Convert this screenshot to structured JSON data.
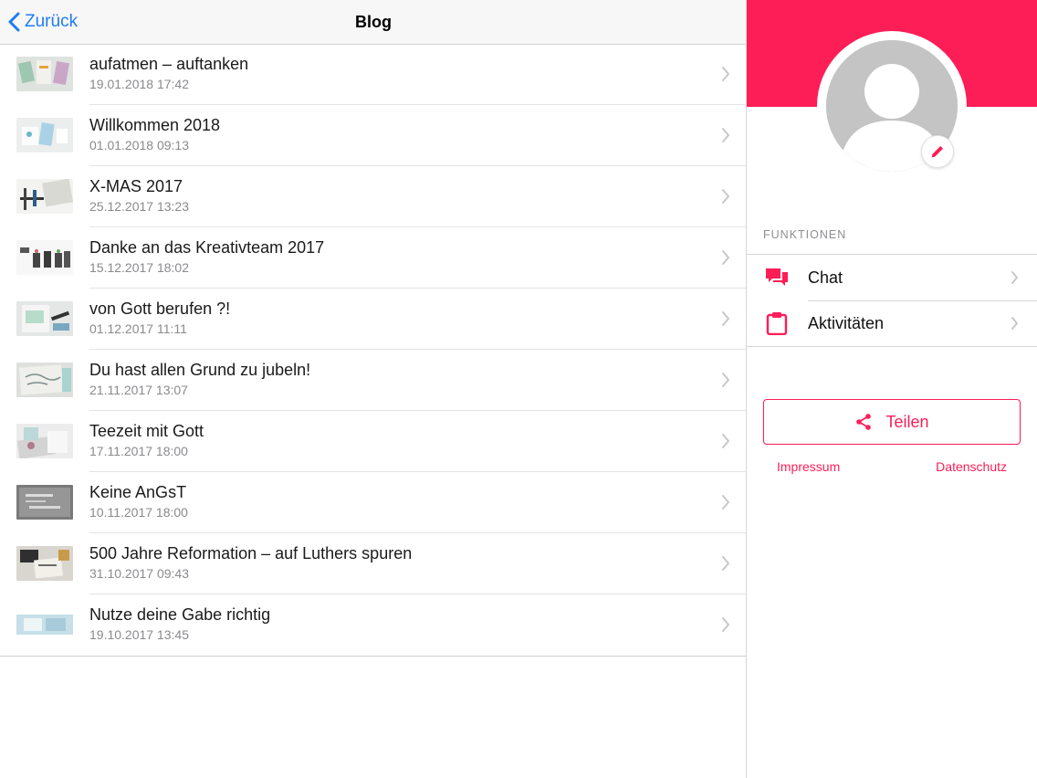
{
  "colors": {
    "accent": "#fd1d57",
    "ios_blue": "#1f7cf2",
    "chevron": "#c7c7cc"
  },
  "navbar": {
    "back_label": "Zurück",
    "title": "Blog"
  },
  "posts": [
    {
      "title": "aufatmen – auftanken",
      "date": "19.01.2018 17:42"
    },
    {
      "title": "Willkommen 2018",
      "date": "01.01.2018 09:13"
    },
    {
      "title": "X-MAS 2017",
      "date": "25.12.2017 13:23"
    },
    {
      "title": "Danke an das Kreativteam 2017",
      "date": "15.12.2017 18:02"
    },
    {
      "title": "von Gott berufen ?!",
      "date": "01.12.2017 11:11"
    },
    {
      "title": "Du hast allen Grund zu jubeln!",
      "date": "21.11.2017 13:07"
    },
    {
      "title": "Teezeit mit Gott",
      "date": "17.11.2017 18:00"
    },
    {
      "title": "Keine AnGsT",
      "date": "10.11.2017 18:00"
    },
    {
      "title": "500 Jahre Reformation – auf Luthers spuren",
      "date": "31.10.2017 09:43"
    },
    {
      "title": "Nutze deine Gabe richtig",
      "date": "19.10.2017 13:45"
    }
  ],
  "profile": {
    "section_label": "FUNKTIONEN",
    "functions": [
      {
        "label": "Chat",
        "icon": "chat-icon"
      },
      {
        "label": "Aktivitäten",
        "icon": "clipboard-icon"
      }
    ],
    "share_label": "Teilen",
    "impressum_label": "Impressum",
    "datenschutz_label": "Datenschutz"
  }
}
